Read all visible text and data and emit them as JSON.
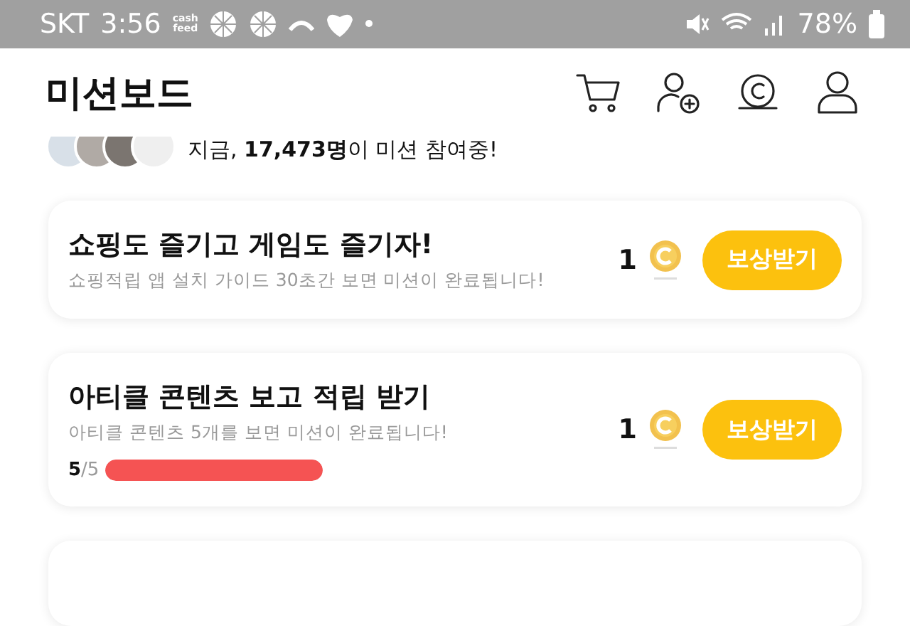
{
  "status_bar": {
    "carrier": "SKT",
    "time": "3:56",
    "app_logo": [
      "cash",
      "feed"
    ],
    "battery": "78%"
  },
  "header": {
    "title": "미션보드"
  },
  "participants": {
    "text": "지금, **17,473명**이 미션 참여중!"
  },
  "missions": [
    {
      "title": "쇼핑도 즐기고 게임도 즐기자!",
      "description": "쇼핑적립 앱 설치 가이드 30초간 보면 미션이 완료됩니다!",
      "reward": "1",
      "button": "보상받기"
    },
    {
      "title": "아티클 콘텐츠 보고 적립 받기",
      "description": "아티클 콘텐츠 5개를 보면 미션이 완료됩니다!",
      "reward": "1",
      "button": "보상받기",
      "progress": {
        "text": "**5**/5",
        "level": 1
      }
    }
  ]
}
